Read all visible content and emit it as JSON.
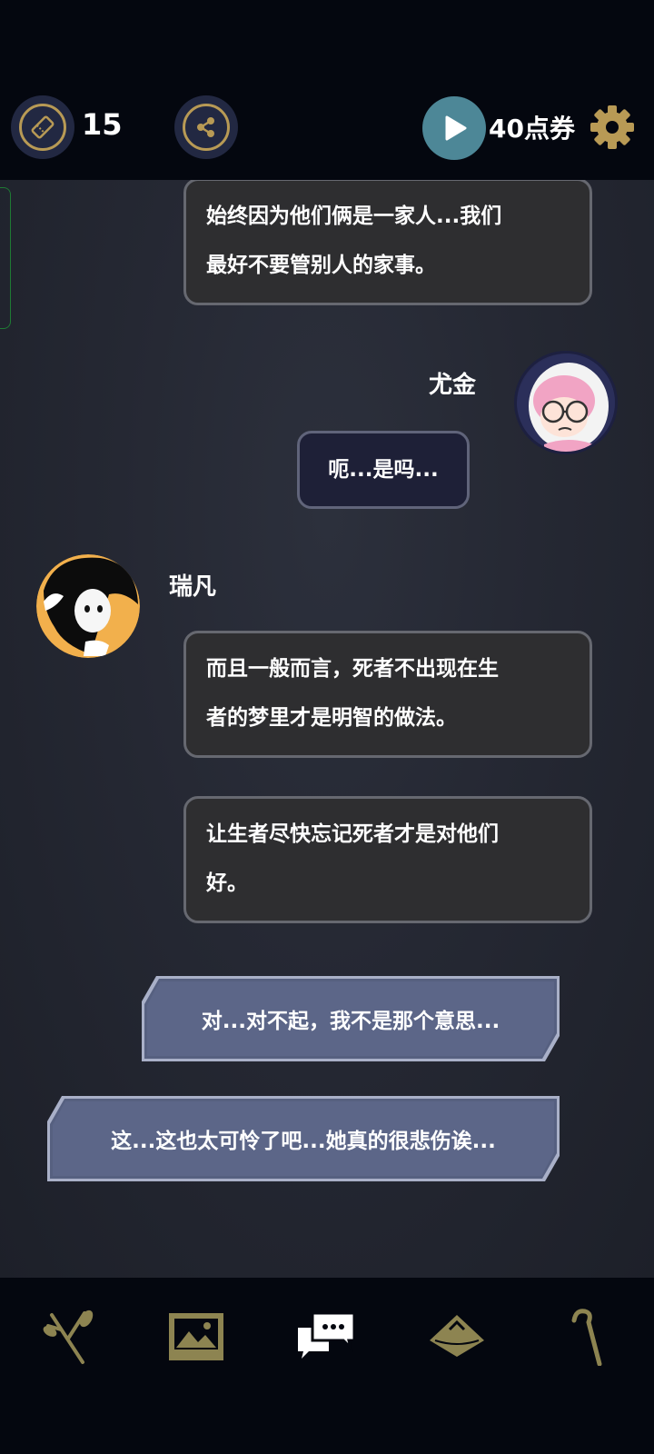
{
  "topbar": {
    "ticket_icon": "ticket-icon",
    "ticket_count": "15",
    "share_icon": "share-icon",
    "play_icon": "play-icon",
    "points_label": "40点券",
    "settings_icon": "gear-icon"
  },
  "colors": {
    "gold": "#b89a55",
    "play_bg": "#4d8797",
    "nav_active": "#ffffff",
    "nav_inactive": "#8d8451"
  },
  "chat": {
    "messages": [
      {
        "text_line1": "始终因为他们俩是一家人...我们",
        "text_line2": "最好不要管别人的家事。"
      },
      {
        "speaker": "尤金",
        "text": "呃...是吗..."
      },
      {
        "speaker": "瑞凡",
        "text_line1": "而且一般而言，死者不出现在生",
        "text_line2": "者的梦里才是明智的做法。"
      },
      {
        "text_line1": "让生者尽快忘记死者才是对他们",
        "text_line2": "好。"
      }
    ],
    "choices": [
      "对...对不起，我不是那个意思...",
      "这...这也太可怜了吧...她真的很悲伤诶..."
    ]
  },
  "bottom_nav": {
    "items": [
      {
        "icon": "branch-icon"
      },
      {
        "icon": "gallery-icon"
      },
      {
        "icon": "chat-icon",
        "active": true
      },
      {
        "icon": "map-icon"
      },
      {
        "icon": "cane-icon"
      }
    ]
  }
}
